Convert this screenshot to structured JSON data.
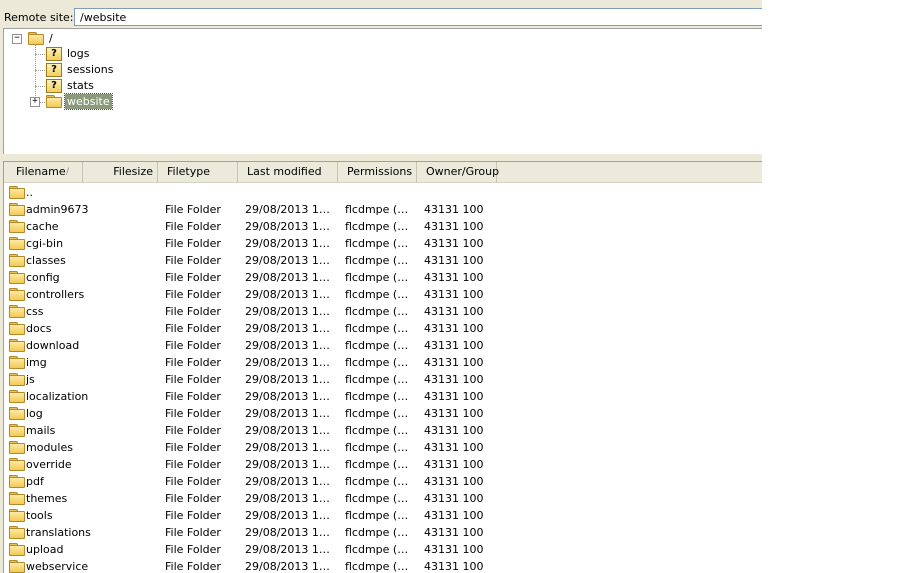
{
  "remote_site": {
    "label": "Remote site:",
    "path": "/website"
  },
  "tree": {
    "root": "/",
    "children": [
      {
        "name": "logs",
        "icon": "question-folder-icon"
      },
      {
        "name": "sessions",
        "icon": "question-folder-icon"
      },
      {
        "name": "stats",
        "icon": "question-folder-icon"
      },
      {
        "name": "website",
        "icon": "folder-icon",
        "selected": true
      }
    ]
  },
  "list": {
    "columns": [
      "Filename",
      "Filesize",
      "Filetype",
      "Last modified",
      "Permissions",
      "Owner/Group"
    ],
    "sort_indicator": "/",
    "parent": "..",
    "rows": [
      {
        "name": "admin9673",
        "type": "File Folder",
        "modified": "29/08/2013 12:...",
        "perms": "flcdmpe (02...",
        "owner": "43131 100"
      },
      {
        "name": "cache",
        "type": "File Folder",
        "modified": "29/08/2013 12:...",
        "perms": "flcdmpe (02...",
        "owner": "43131 100"
      },
      {
        "name": "cgi-bin",
        "type": "File Folder",
        "modified": "29/08/2013 12:...",
        "perms": "flcdmpe (02...",
        "owner": "43131 100"
      },
      {
        "name": "classes",
        "type": "File Folder",
        "modified": "29/08/2013 12:...",
        "perms": "flcdmpe (02...",
        "owner": "43131 100"
      },
      {
        "name": "config",
        "type": "File Folder",
        "modified": "29/08/2013 12:...",
        "perms": "flcdmpe (02...",
        "owner": "43131 100"
      },
      {
        "name": "controllers",
        "type": "File Folder",
        "modified": "29/08/2013 12:...",
        "perms": "flcdmpe (02...",
        "owner": "43131 100"
      },
      {
        "name": "css",
        "type": "File Folder",
        "modified": "29/08/2013 12:...",
        "perms": "flcdmpe (02...",
        "owner": "43131 100"
      },
      {
        "name": "docs",
        "type": "File Folder",
        "modified": "29/08/2013 12:...",
        "perms": "flcdmpe (02...",
        "owner": "43131 100"
      },
      {
        "name": "download",
        "type": "File Folder",
        "modified": "29/08/2013 12:...",
        "perms": "flcdmpe (02...",
        "owner": "43131 100"
      },
      {
        "name": "img",
        "type": "File Folder",
        "modified": "29/08/2013 12:...",
        "perms": "flcdmpe (02...",
        "owner": "43131 100"
      },
      {
        "name": "js",
        "type": "File Folder",
        "modified": "29/08/2013 12:...",
        "perms": "flcdmpe (02...",
        "owner": "43131 100"
      },
      {
        "name": "localization",
        "type": "File Folder",
        "modified": "29/08/2013 12:...",
        "perms": "flcdmpe (02...",
        "owner": "43131 100"
      },
      {
        "name": "log",
        "type": "File Folder",
        "modified": "29/08/2013 12:...",
        "perms": "flcdmpe (02...",
        "owner": "43131 100"
      },
      {
        "name": "mails",
        "type": "File Folder",
        "modified": "29/08/2013 12:...",
        "perms": "flcdmpe (02...",
        "owner": "43131 100"
      },
      {
        "name": "modules",
        "type": "File Folder",
        "modified": "29/08/2013 12:...",
        "perms": "flcdmpe (02...",
        "owner": "43131 100"
      },
      {
        "name": "override",
        "type": "File Folder",
        "modified": "29/08/2013 12:...",
        "perms": "flcdmpe (02...",
        "owner": "43131 100"
      },
      {
        "name": "pdf",
        "type": "File Folder",
        "modified": "29/08/2013 12:...",
        "perms": "flcdmpe (02...",
        "owner": "43131 100"
      },
      {
        "name": "themes",
        "type": "File Folder",
        "modified": "29/08/2013 12:...",
        "perms": "flcdmpe (02...",
        "owner": "43131 100"
      },
      {
        "name": "tools",
        "type": "File Folder",
        "modified": "29/08/2013 12:...",
        "perms": "flcdmpe (02...",
        "owner": "43131 100"
      },
      {
        "name": "translations",
        "type": "File Folder",
        "modified": "29/08/2013 12:...",
        "perms": "flcdmpe (02...",
        "owner": "43131 100"
      },
      {
        "name": "upload",
        "type": "File Folder",
        "modified": "29/08/2013 12:...",
        "perms": "flcdmpe (02...",
        "owner": "43131 100"
      },
      {
        "name": "webservice",
        "type": "File Folder",
        "modified": "29/08/2013 12:...",
        "perms": "flcdmpe (02...",
        "owner": "43131 100"
      }
    ]
  },
  "colors": {
    "selection": "#8b9a7b",
    "folder": "#f2c955",
    "header_bg": "#ebeadb"
  }
}
